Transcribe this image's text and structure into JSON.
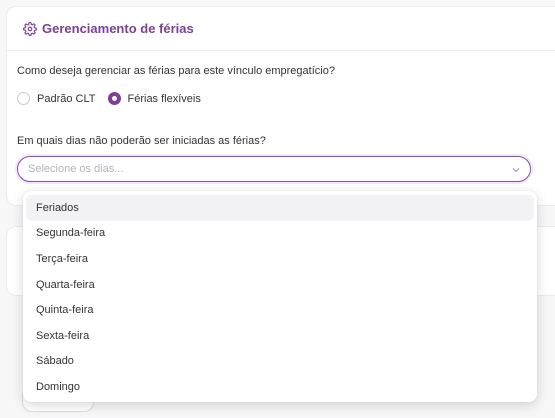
{
  "card": {
    "title": "Gerenciamento de férias",
    "question_manage": "Como deseja gerenciar as férias para este vínculo empregatício?",
    "radio_options": [
      {
        "label": "Padrão CLT",
        "checked": false
      },
      {
        "label": "Férias flexíveis",
        "checked": true
      }
    ],
    "question_days": "Em quais dias não poderão ser iniciadas as férias?"
  },
  "select": {
    "placeholder": "Selecione os dias..."
  },
  "dropdown": {
    "options": [
      "Feriados",
      "Segunda-feira",
      "Terça-feira",
      "Quarta-feira",
      "Quinta-feira",
      "Sexta-feira",
      "Sábado",
      "Domingo"
    ],
    "highlighted": "Feriados"
  },
  "colors": {
    "accent": "#7b3f98",
    "border_focus": "#8e4bb0"
  },
  "icons": {
    "header": "gear-icon",
    "select": "chevron-down-icon"
  }
}
